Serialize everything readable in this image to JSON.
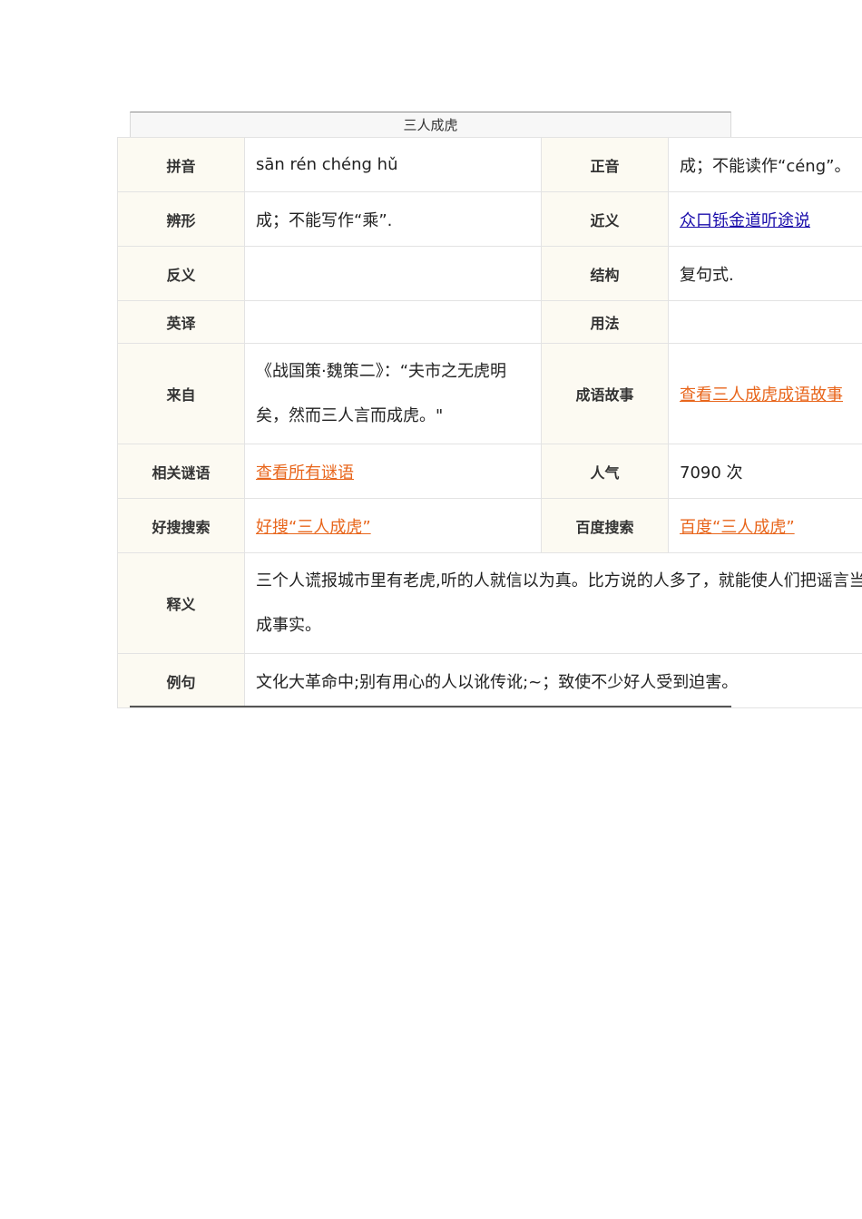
{
  "caption": "三人成虎",
  "rows": {
    "pinyin": {
      "label": "拼音",
      "value": "sān rén chéng hǔ"
    },
    "zhengyin": {
      "label": "正音",
      "value": "成；不能读作“céng”。"
    },
    "bianxing": {
      "label": "辨形",
      "value": "成；不能写作“乘”."
    },
    "jinyi": {
      "label": "近义",
      "value": "众口铄金道听途说"
    },
    "fanyi": {
      "label": "反义",
      "value": ""
    },
    "jiegou": {
      "label": "结构",
      "value": "复句式."
    },
    "yingyi": {
      "label": "英译",
      "value": ""
    },
    "yongfa": {
      "label": "用法",
      "value": ""
    },
    "laizi": {
      "label": "来自",
      "value": "《战国策·魏策二》：“夫市之无虎明矣，然而三人言而成虎。\""
    },
    "gushi": {
      "label": "成语故事",
      "value": "查看三人成虎成语故事"
    },
    "miyu": {
      "label": "相关谜语",
      "value": "查看所有谜语"
    },
    "renqi": {
      "label": "人气",
      "value": "7090 次"
    },
    "haosou": {
      "label": "好搜搜索",
      "value": "好搜“三人成虎”"
    },
    "baidu": {
      "label": "百度搜索",
      "value": "百度“三人成虎”"
    },
    "shiyi": {
      "label": "释义",
      "value": "三个人谎报城市里有老虎,听的人就信以为真。比方说的人多了，就能使人们把谣言当成事实。"
    },
    "liju": {
      "label": "例句",
      "value": "文化大革命中;别有用心的人以讹传讹;~；致使不少好人受到迫害。"
    }
  }
}
